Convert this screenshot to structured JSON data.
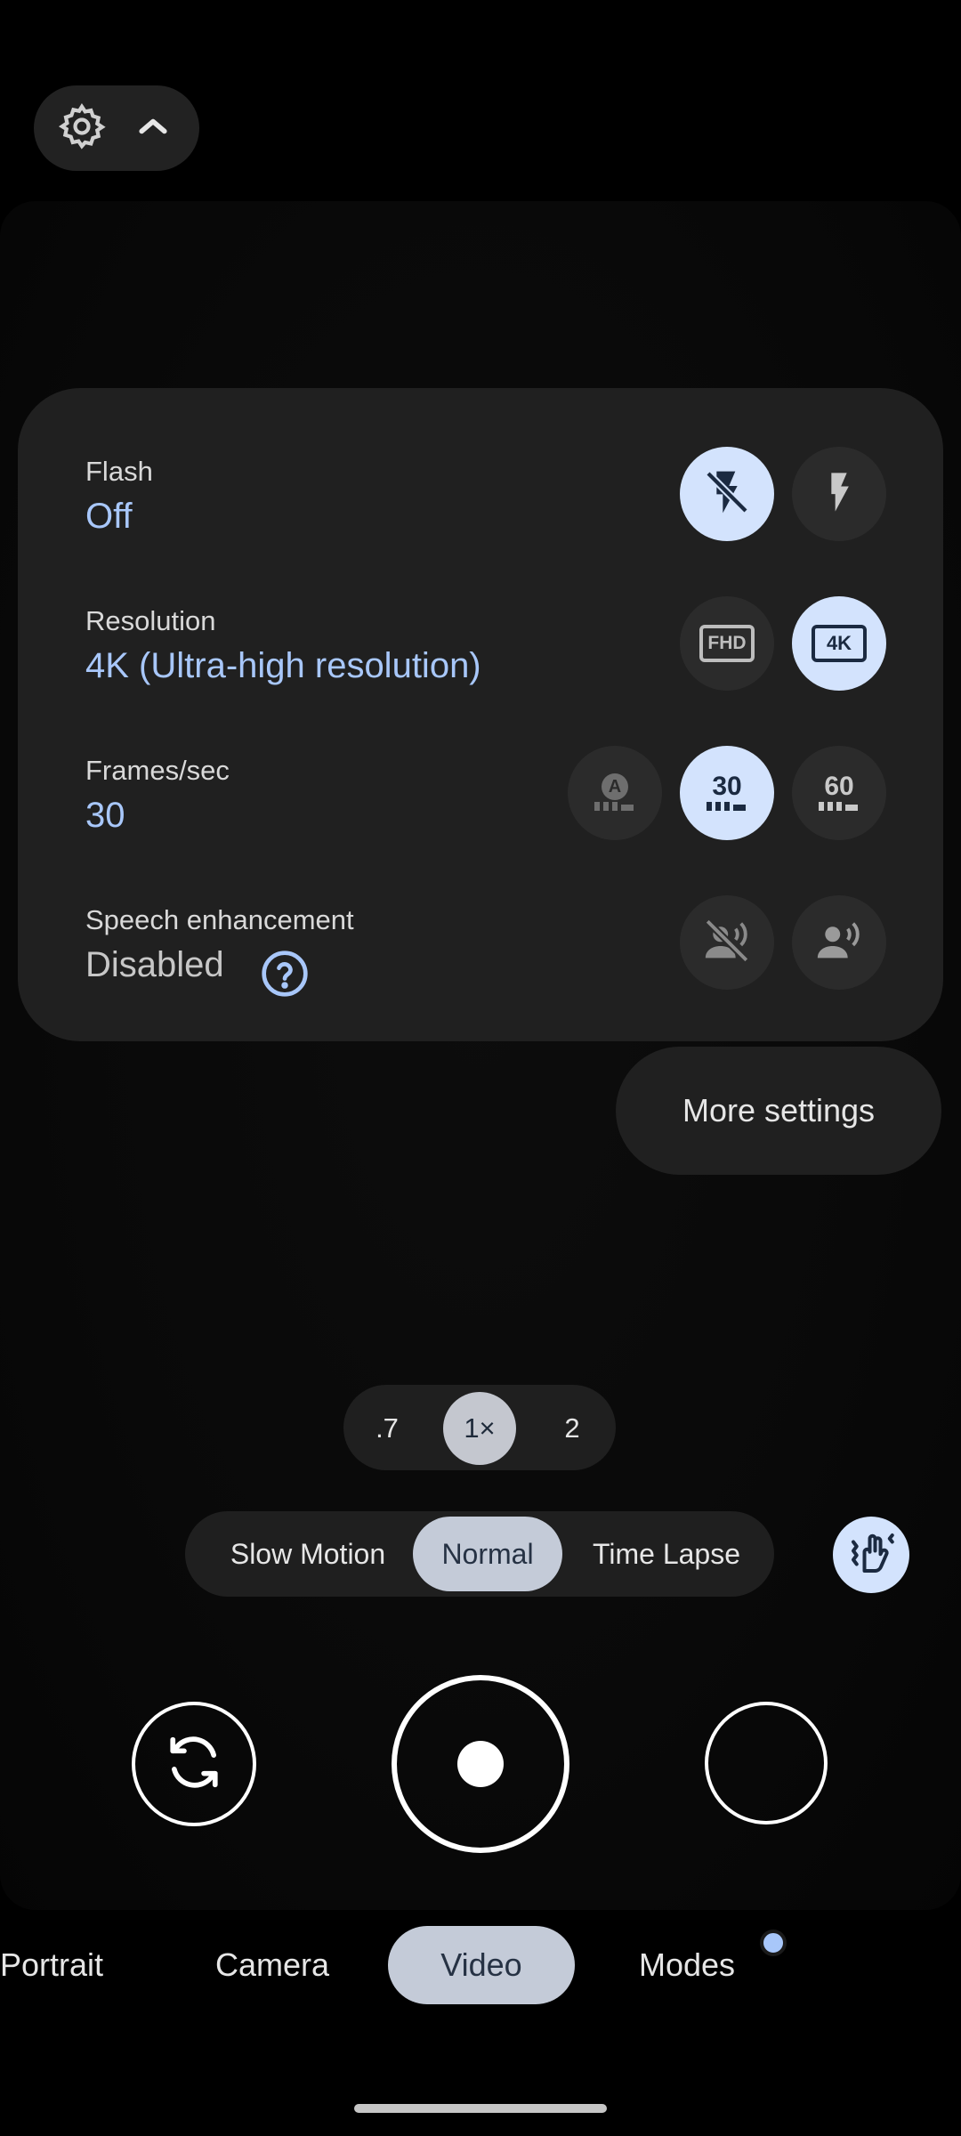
{
  "quick_settings": {
    "flash": {
      "label": "Flash",
      "value": "Off",
      "options": [
        {
          "icon": "flash-off-icon",
          "selected": true
        },
        {
          "icon": "flash-on-icon",
          "selected": false
        }
      ]
    },
    "resolution": {
      "label": "Resolution",
      "value": "4K (Ultra-high resolution)",
      "options": [
        {
          "icon": "fhd-icon",
          "text": "FHD",
          "selected": false
        },
        {
          "icon": "4k-icon",
          "text": "4K",
          "selected": true
        }
      ]
    },
    "fps": {
      "label": "Frames/sec",
      "value": "30",
      "options": [
        {
          "icon": "auto-fps-icon",
          "text": "A",
          "selected": false
        },
        {
          "icon": "fps-30-icon",
          "text": "30",
          "selected": true
        },
        {
          "icon": "fps-60-icon",
          "text": "60",
          "selected": false
        }
      ]
    },
    "speech": {
      "label": "Speech enhancement",
      "value": "Disabled",
      "options": [
        {
          "icon": "speech-off-icon",
          "selected": false
        },
        {
          "icon": "speech-on-icon",
          "selected": false
        }
      ]
    }
  },
  "more_settings_label": "More settings",
  "zoom": {
    "options": [
      ".7",
      "1×",
      "2"
    ],
    "selected": "1×"
  },
  "speed_modes": {
    "options": [
      "Slow Motion",
      "Normal",
      "Time Lapse"
    ],
    "selected": "Normal"
  },
  "mode_tabs": {
    "options": [
      "Portrait",
      "Camera",
      "Video",
      "Modes"
    ],
    "selected": "Video"
  },
  "colors": {
    "accent": "#a8c7fa",
    "active_chip": "#d3e3fd",
    "panel": "#202020",
    "selected_pill": "#c4cbd8"
  }
}
